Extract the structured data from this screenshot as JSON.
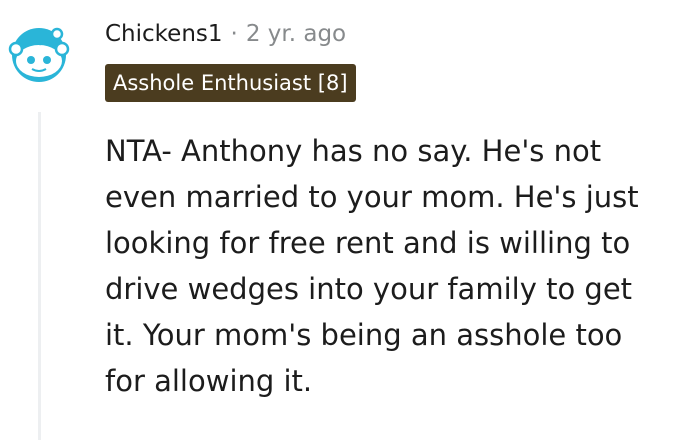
{
  "comment": {
    "username": "Chickens1",
    "separator": "·",
    "timestamp": "2 yr. ago",
    "flair": "Asshole Enthusiast [8]",
    "body": "NTA- Anthony has no say. He's not\neven married to your mom. He's just\nlooking for free rent and is willing to\ndrive wedges into your family to get\nit. Your mom's being an asshole too\nfor allowing it."
  },
  "avatar": {
    "icon": "reddit-snoo-icon",
    "color": "#0dd3bb"
  },
  "flair_color": "#4b3c1f"
}
